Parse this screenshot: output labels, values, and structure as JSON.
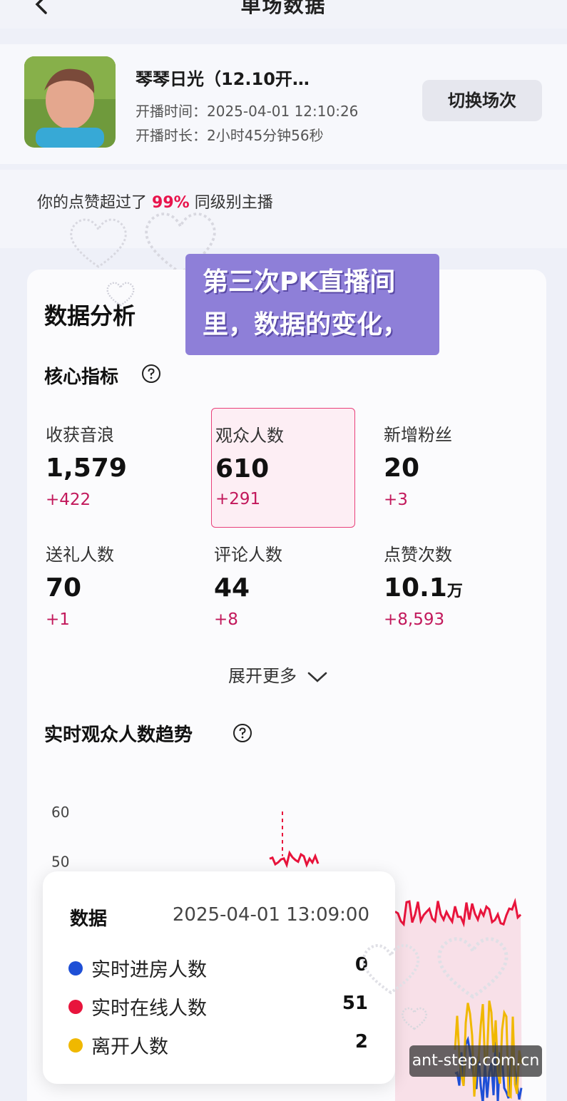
{
  "topbar": {
    "title": "单场数据"
  },
  "header": {
    "streamer_name": "琴琴日光（12.10开…",
    "start_time": "开播时间：2025-04-01 12:10:26",
    "duration": "开播时长：2小时45分钟56秒",
    "switch_label": "切换场次"
  },
  "rank": {
    "prefix": "你的点赞超过了",
    "pct": "99%",
    "suffix": "同级别主播"
  },
  "sticker": {
    "line1": "第三次PK直播间",
    "line2": "里，数据的变化，"
  },
  "analysis": {
    "title": "数据分析",
    "core_title": "核心指标",
    "metrics": [
      {
        "label": "收获音浪",
        "value": "1,579",
        "unit": "",
        "delta": "+422"
      },
      {
        "label": "观众人数",
        "value": "610",
        "unit": "",
        "delta": "+291"
      },
      {
        "label": "新增粉丝",
        "value": "20",
        "unit": "",
        "delta": "+3"
      },
      {
        "label": "送礼人数",
        "value": "70",
        "unit": "",
        "delta": "+1"
      },
      {
        "label": "评论人数",
        "value": "44",
        "unit": "",
        "delta": "+8"
      },
      {
        "label": "点赞次数",
        "value": "10.1",
        "unit": "万",
        "delta": "+8,593"
      }
    ],
    "expand_label": "展开更多",
    "trend_title": "实时观众人数趋势"
  },
  "chart_data": {
    "type": "line",
    "ylim": [
      0,
      60
    ],
    "y_ticks": [
      "60",
      "50"
    ],
    "series": [
      {
        "name": "实时进房人数",
        "color": "#1e4fd6"
      },
      {
        "name": "实时在线人数",
        "color": "#e8143c"
      },
      {
        "name": "离开人数",
        "color": "#f0b800"
      }
    ]
  },
  "tooltip": {
    "title": "数据",
    "time": "2025-04-01 13:09:00",
    "rows": [
      {
        "label": "实时进房人数",
        "value": "0",
        "color": "#1e4fd6"
      },
      {
        "label": "实时在线人数",
        "value": "51",
        "color": "#e8143c"
      },
      {
        "label": "离开人数",
        "value": "2",
        "color": "#f0b800"
      }
    ]
  },
  "watermark": "ant-step.com.cn"
}
